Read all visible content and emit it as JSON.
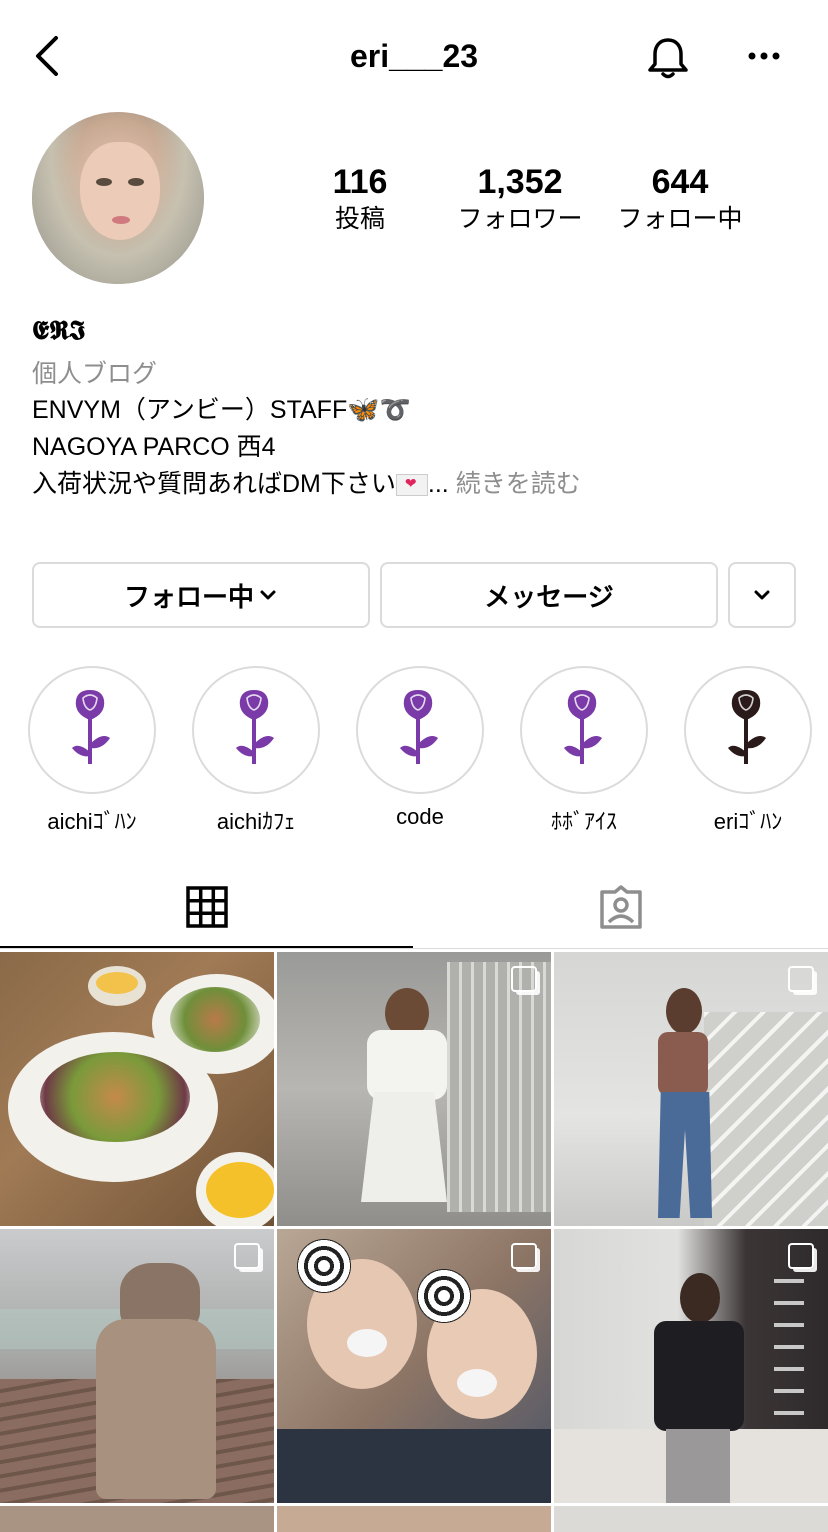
{
  "header": {
    "username": "eri___23"
  },
  "stats": [
    {
      "value": "116",
      "label": "投稿"
    },
    {
      "value": "1,352",
      "label": "フォロワー"
    },
    {
      "value": "644",
      "label": "フォロー中"
    }
  ],
  "bio": {
    "name": "𝕰𝕽𝕴",
    "category": "個人ブログ",
    "line1": "ENVYM（アンビー）STAFF",
    "line1_suffix": "➰",
    "line2": "NAGOYA PARCO  西4",
    "line3": "入荷状況や質問あればDM下さい",
    "ellipsis": "...",
    "more": "続きを読む"
  },
  "buttons": {
    "following": "フォロー中",
    "message": "メッセージ"
  },
  "highlights": [
    {
      "label": "aichiｺﾞﾊﾝ",
      "color": "#7a3aa8"
    },
    {
      "label": "aichiｶﾌｪ",
      "color": "#7a3aa8"
    },
    {
      "label": "code",
      "color": "#7a3aa8"
    },
    {
      "label": "ﾎﾎﾞｱｲｽ",
      "color": "#7a3aa8"
    },
    {
      "label": "eriｺﾞﾊﾝ",
      "color": "#2a1a1a"
    }
  ],
  "colors": {
    "secondary_text": "#8e8e8e",
    "border": "#dbdbdb"
  }
}
